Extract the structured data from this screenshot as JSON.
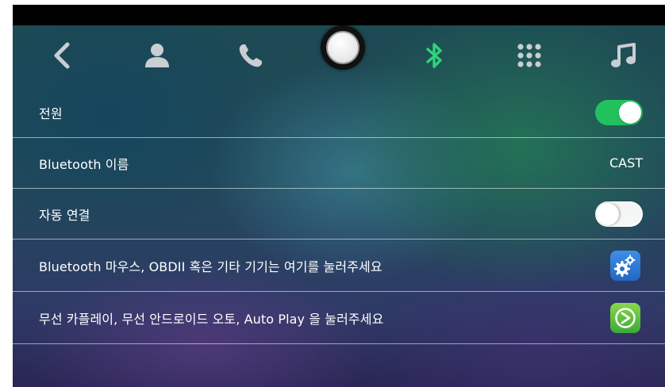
{
  "colors": {
    "accent_green": "#21c25e",
    "bluetooth_active": "#2ed37a",
    "icon_gray": "#c9ced2"
  },
  "nav": {
    "items": [
      {
        "icon": "back-icon"
      },
      {
        "icon": "contacts-icon"
      },
      {
        "icon": "phone-icon"
      },
      {
        "icon": "home-button"
      },
      {
        "icon": "bluetooth-icon",
        "active": true
      },
      {
        "icon": "dialpad-icon"
      },
      {
        "icon": "music-icon"
      }
    ]
  },
  "settings": {
    "power": {
      "label": "전원",
      "toggle": "on"
    },
    "bt_name": {
      "label": "Bluetooth 이름",
      "value": "CAST"
    },
    "auto_connect": {
      "label": "자동 연결",
      "toggle": "off"
    },
    "bt_devices": {
      "label": "Bluetooth 마우스, OBDII 혹은 기타 기기는 여기를 눌러주세요",
      "icon": "gears-app-icon"
    },
    "wireless": {
      "label": "무선 카플레이, 무선 안드로이드 오토, Auto Play 을 눌러주세요",
      "icon": "autoplay-app-icon"
    }
  }
}
